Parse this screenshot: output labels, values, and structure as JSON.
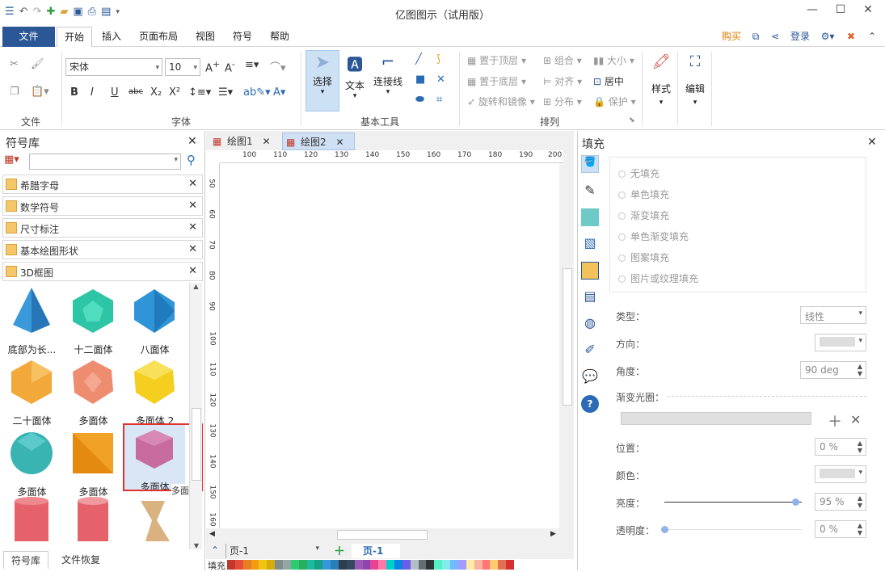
{
  "window": {
    "title": "亿图图示（试用版）"
  },
  "menu": {
    "file": "文件",
    "tabs": [
      "开始",
      "插入",
      "页面布局",
      "视图",
      "符号",
      "帮助"
    ],
    "buy": "购买",
    "login": "登录"
  },
  "ribbon": {
    "groups": {
      "file": "文件",
      "font": "字体",
      "basic_tools": "基本工具",
      "arrange": "排列"
    },
    "font_name": "宋体",
    "font_size": "10",
    "select": "选择",
    "text": "文本",
    "connector": "连接线",
    "arrange_items": [
      "置于顶层",
      "组合",
      "大小",
      "置于底层",
      "对齐",
      "居中",
      "旋转和镜像",
      "分布",
      "保护"
    ],
    "style": "样式",
    "edit": "编辑"
  },
  "symbol_library": {
    "title": "符号库",
    "search_placeholder": "",
    "libraries": [
      "希腊字母",
      "数学符号",
      "尺寸标注",
      "基本绘图形状",
      "3D框图"
    ],
    "shapes": [
      {
        "label": "底部为长...",
        "color": "#3a9ad9"
      },
      {
        "label": "十二面体",
        "color": "#2ec4a6"
      },
      {
        "label": "八面体",
        "color": "#2f95d6"
      },
      {
        "label": "二十面体",
        "color": "#f3a93a"
      },
      {
        "label": "多面体",
        "color": "#ee8c70"
      },
      {
        "label": "多面体 2",
        "color": "#f4cf1f"
      },
      {
        "label": "多面体",
        "color": "#3ab3b3"
      },
      {
        "label": "多面体",
        "color": "#f1a125"
      },
      {
        "label": "多面体",
        "color": "#c86ca0"
      },
      {
        "label": "",
        "color": "#e5626a"
      },
      {
        "label": "",
        "color": "#e5626a"
      },
      {
        "label": "",
        "color": "#d9b27f"
      }
    ],
    "tooltip": "多面体",
    "bottom_tabs": [
      "符号库",
      "文件恢复"
    ]
  },
  "documents": {
    "tabs": [
      "绘图1",
      "绘图2"
    ]
  },
  "ruler_h": [
    "100",
    "110",
    "120",
    "130",
    "140",
    "150",
    "160",
    "170",
    "180",
    "190",
    "200"
  ],
  "ruler_v": [
    "50",
    "60",
    "70",
    "80",
    "90",
    "100",
    "110",
    "120",
    "130",
    "140",
    "150",
    "160"
  ],
  "pages": {
    "selector": "页-1",
    "current": "页-1"
  },
  "fill_label": "填充",
  "fill_panel": {
    "title": "填充",
    "options": [
      "无填充",
      "单色填充",
      "渐变填充",
      "单色渐变填充",
      "图案填充",
      "图片或纹理填充"
    ],
    "type_label": "类型：",
    "type_value": "线性",
    "direction_label": "方向：",
    "angle_label": "角度：",
    "angle_value": "90 deg",
    "gradient_stop_label": "渐变光圈：",
    "position_label": "位置：",
    "position_value": "0 %",
    "color_label": "颜色：",
    "brightness_label": "亮度：",
    "brightness_value": "95 %",
    "transparency_label": "透明度：",
    "transparency_value": "0 %"
  },
  "colors": {
    "accent": "#2b5797",
    "buy": "#e07b00",
    "tab_active": "#2b6ab4"
  }
}
